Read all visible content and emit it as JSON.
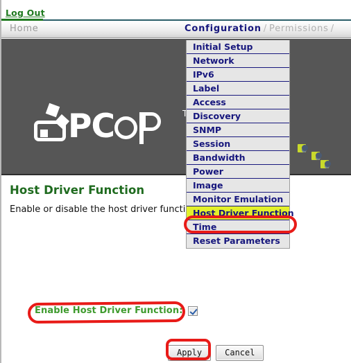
{
  "topbar": {
    "logout_label": "Log Out"
  },
  "navbar": {
    "home_label": "Home",
    "current_label": "Configuration",
    "separator": "/",
    "next_label": "Permissions",
    "trailing_separator": "/",
    "current_color": "#17177d",
    "inactive_color": "#b0b0b0"
  },
  "banner": {
    "logo_prefix": "PC",
    "logo_trademark": "TM",
    "logo_alt": "PCoIP",
    "background_color": "#565656"
  },
  "menu": {
    "items": [
      {
        "label": "Initial Setup",
        "highlighted": false
      },
      {
        "label": "Network",
        "highlighted": false
      },
      {
        "label": "IPv6",
        "highlighted": false
      },
      {
        "label": "Label",
        "highlighted": false
      },
      {
        "label": "Access",
        "highlighted": false
      },
      {
        "label": "Discovery",
        "highlighted": false
      },
      {
        "label": "SNMP",
        "highlighted": false
      },
      {
        "label": "Session",
        "highlighted": false
      },
      {
        "label": "Bandwidth",
        "highlighted": false
      },
      {
        "label": "Power",
        "highlighted": false
      },
      {
        "label": "Image",
        "highlighted": false
      },
      {
        "label": "Monitor Emulation",
        "highlighted": false
      },
      {
        "label": "Host Driver Function",
        "highlighted": true
      },
      {
        "label": "Time",
        "highlighted": false
      },
      {
        "label": "Reset Parameters",
        "highlighted": false
      }
    ],
    "highlight_color": "#e3f02a",
    "text_color": "#17177d"
  },
  "main": {
    "title": "Host Driver Function",
    "title_color": "#1f6b1f",
    "description": "Enable or disable the host driver function.",
    "checkbox_label": "Enable Host Driver Function:",
    "checkbox_label_color": "#3f9b2e",
    "checkbox_checked": true,
    "apply_label": "Apply",
    "cancel_label": "Cancel"
  },
  "annotations": {
    "color": "#e81b18",
    "shapes": [
      {
        "target": "menu-item-host-driver-function",
        "shape": "oval"
      },
      {
        "target": "enable-host-driver-function-row",
        "shape": "oval"
      },
      {
        "target": "apply-button",
        "shape": "rounded-rect"
      }
    ]
  }
}
